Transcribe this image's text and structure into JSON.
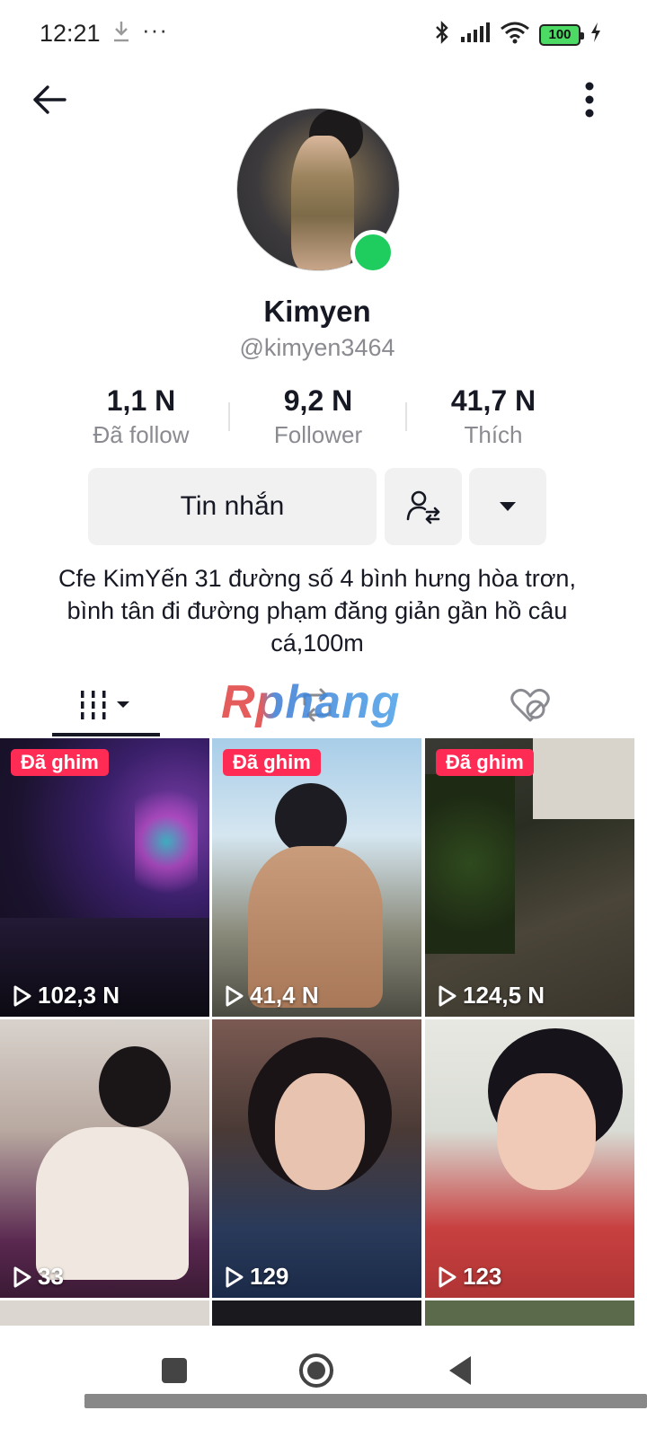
{
  "status_bar": {
    "time": "12:21",
    "more": "···",
    "battery": "100"
  },
  "profile": {
    "display_name": "Kimyen",
    "username": "@kimyen3464",
    "online_color": "#1fcd5f"
  },
  "stats": [
    {
      "value": "1,1 N",
      "label": "Đã follow"
    },
    {
      "value": "9,2 N",
      "label": "Follower"
    },
    {
      "value": "41,7 N",
      "label": "Thích"
    }
  ],
  "actions": {
    "message_label": "Tin nhắn"
  },
  "bio": "Cfe KimYến 31 đường số 4 bình hưng hòa trơn, bình tân đi đường phạm đăng giản gần hồ câu cá,100m",
  "watermark": "Rphang",
  "accent_color": "#fe2c55",
  "videos": [
    {
      "pinned_label": "Đã ghim",
      "views": "102,3 N"
    },
    {
      "pinned_label": "Đã ghim",
      "views": "41,4 N"
    },
    {
      "pinned_label": "Đã ghim",
      "views": "124,5 N"
    },
    {
      "pinned_label": "",
      "views": "33"
    },
    {
      "pinned_label": "",
      "views": "129"
    },
    {
      "pinned_label": "",
      "views": "123"
    }
  ]
}
